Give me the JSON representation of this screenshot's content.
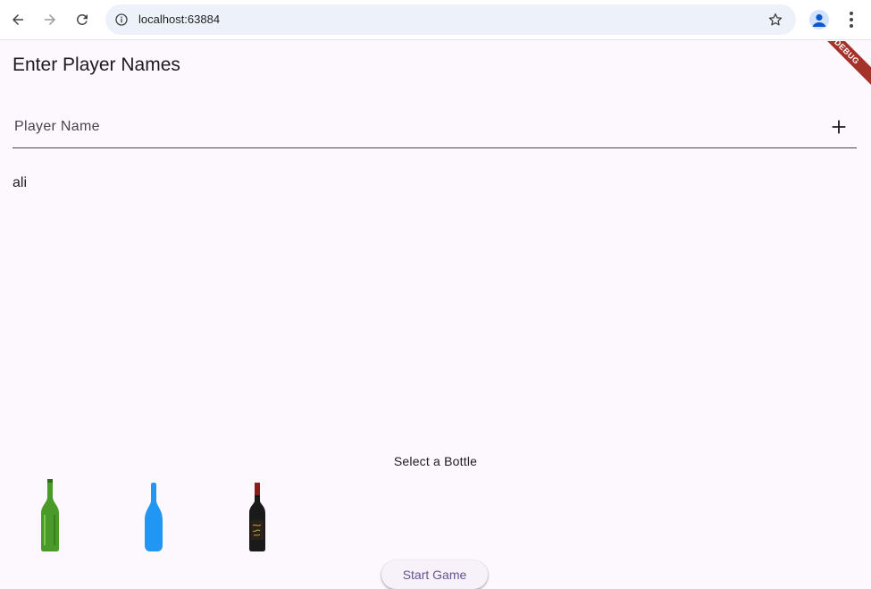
{
  "browser": {
    "url": "localhost:63884",
    "back_icon": "arrow-left-icon",
    "forward_icon": "arrow-right-icon",
    "reload_icon": "reload-icon",
    "info_icon": "info-icon",
    "star_icon": "star-icon",
    "profile_icon": "profile-icon",
    "menu_icon": "more-vert-icon"
  },
  "app": {
    "title": "Enter Player Names",
    "debug_banner": "DEBUG",
    "input": {
      "placeholder": "Player Name",
      "value": "",
      "add_icon": "plus-icon"
    },
    "players": [
      "ali"
    ],
    "select_label": "Select a Bottle",
    "bottles": [
      {
        "name": "green-bottle",
        "color": "#4a9a2a"
      },
      {
        "name": "blue-bottle",
        "color": "#2196f3"
      },
      {
        "name": "wine-bottle",
        "color": "#1a1a1a"
      }
    ],
    "start_button": "Start Game"
  },
  "colors": {
    "background": "#fdf7fe",
    "accent": "#65558f",
    "debug": "#a5312b"
  }
}
